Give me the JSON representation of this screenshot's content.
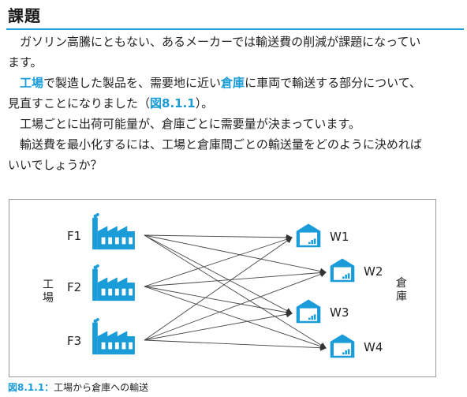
{
  "heading": "課題",
  "paragraphs": [
    {
      "lines": [
        [
          {
            "t": "　ガソリン高騰にともない、あるメーカーでは輸送費の削減が課題になってい"
          }
        ],
        [
          {
            "t": "ます。"
          }
        ]
      ]
    },
    {
      "lines": [
        [
          {
            "t": "　"
          },
          {
            "t": "工場",
            "a": true
          },
          {
            "t": "で製造した製品を、需要地に近い"
          },
          {
            "t": "倉庫",
            "a": true
          },
          {
            "t": "に車両で輸送する部分について、"
          }
        ],
        [
          {
            "t": "見直すことになりました（"
          },
          {
            "t": "図8.1.1",
            "a": true
          },
          {
            "t": "）。"
          }
        ]
      ]
    },
    {
      "lines": [
        [
          {
            "t": "　工場ごとに出荷可能量が、倉庫ごとに需要量が決まっています。"
          }
        ]
      ]
    },
    {
      "lines": [
        [
          {
            "t": "　輸送費を最小化するには、工場と倉庫間ごとの輸送量をどのように決めれば"
          }
        ],
        [
          {
            "t": "いいでしょうか？"
          }
        ]
      ]
    }
  ],
  "figure": {
    "factory_group_label": "工場",
    "warehouse_group_label": "倉庫",
    "factories": [
      "F1",
      "F2",
      "F3"
    ],
    "warehouses": [
      "W1",
      "W2",
      "W3",
      "W4"
    ],
    "accent_color": "#1a9cd8",
    "factory_icon": "factory-icon",
    "warehouse_icon": "warehouse-icon"
  },
  "caption": {
    "number": "図8.1.1：",
    "text": "工場から倉庫への輸送"
  }
}
